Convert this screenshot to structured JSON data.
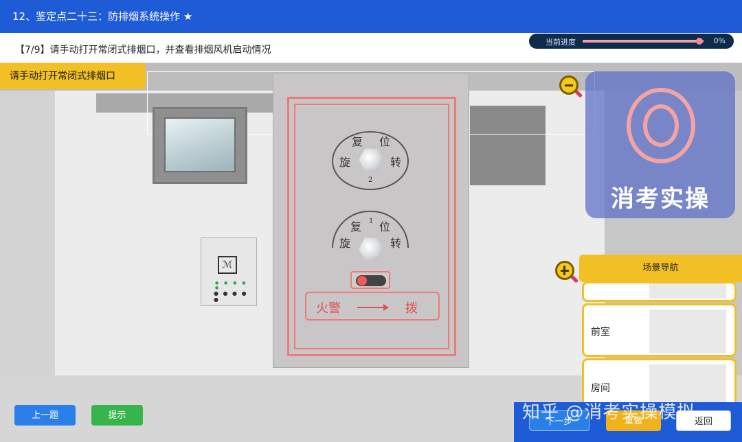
{
  "header": {
    "title": "12、鉴定点二十三：防排烟系统操作 ★"
  },
  "task": {
    "text": "【7/9】请手动打开常闭式排烟口，并查看排烟风机启动情况"
  },
  "progress": {
    "label": "当前进度",
    "value": "0%",
    "fraction": 0.97
  },
  "tip": {
    "text": "请手动打开常闭式排烟口"
  },
  "panel": {
    "knob_top": {
      "tl": "复",
      "tr": "位",
      "bl": "旋",
      "br": "转",
      "num": "2"
    },
    "knob_mid": {
      "tl": "复",
      "tr": "位",
      "bl": "旋",
      "br": "转",
      "num": "1"
    },
    "alarm_left": "火警",
    "alarm_right": "拨"
  },
  "watermark": {
    "text": "消考实操"
  },
  "scene_nav": {
    "title": "场景导航",
    "items": [
      {
        "label": ""
      },
      {
        "label": "前室"
      },
      {
        "label": "房间"
      }
    ]
  },
  "buttons": {
    "prev": "上一题",
    "hint": "提示",
    "next": "下一步",
    "reset": "重做",
    "back": "返回"
  },
  "footer_watermark": "知乎 @消考实操模拟",
  "colors": {
    "header": "#1e5bd6",
    "tip": "#f2c024",
    "accent_red": "#ef7a7a"
  }
}
